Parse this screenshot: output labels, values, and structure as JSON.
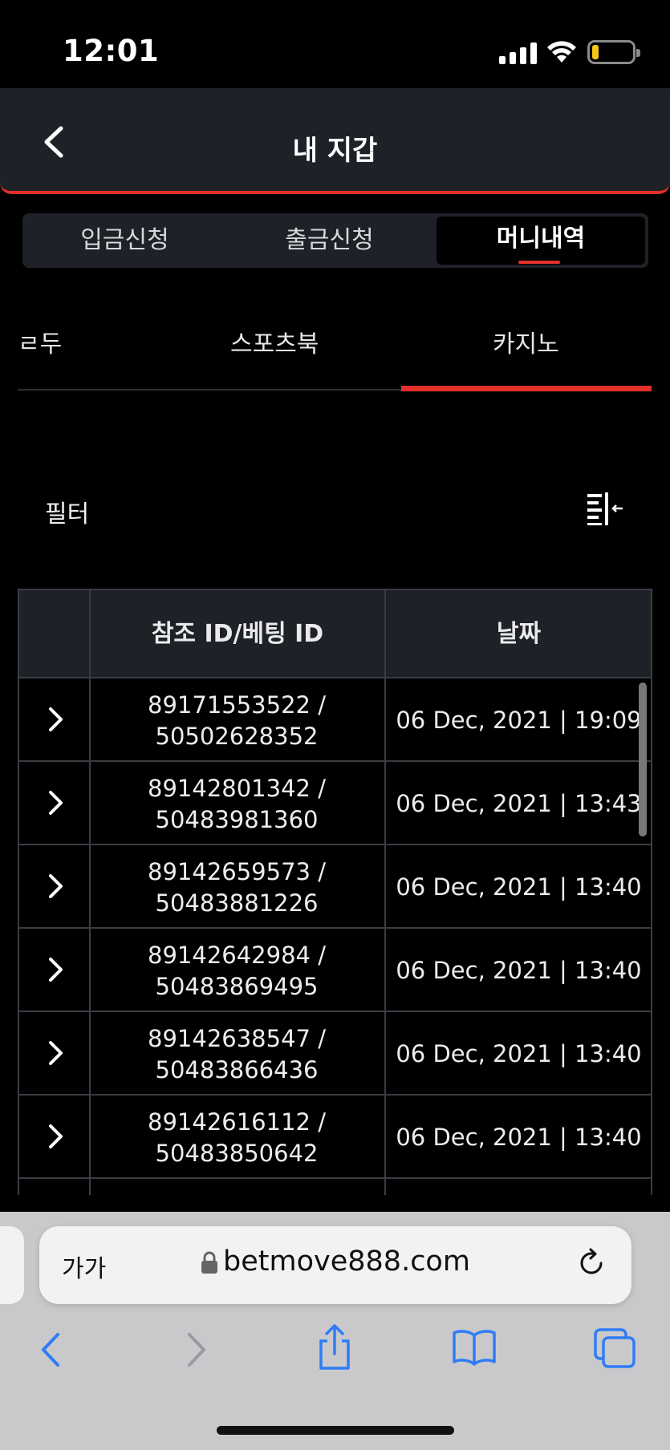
{
  "status": {
    "time": "12:01"
  },
  "header": {
    "title": "내 지갑"
  },
  "segments": [
    {
      "label": "입금신청",
      "active": false
    },
    {
      "label": "출금신청",
      "active": false
    },
    {
      "label": "머니내역",
      "active": true
    }
  ],
  "subtabs": [
    {
      "label": "모두",
      "visible_text": "ㄹ두"
    },
    {
      "label": "스포츠북"
    },
    {
      "label": "카지노",
      "active": true
    }
  ],
  "filter": {
    "label": "필터"
  },
  "table": {
    "columns": [
      "",
      "참조 ID/베팅 ID",
      "날짜"
    ],
    "rows": [
      {
        "ref": "89171553522 /",
        "bet": "50502628352",
        "date": "06 Dec, 2021 | 19:09"
      },
      {
        "ref": "89142801342 /",
        "bet": "50483981360",
        "date": "06 Dec, 2021 | 13:43"
      },
      {
        "ref": "89142659573 /",
        "bet": "50483881226",
        "date": "06 Dec, 2021 | 13:40"
      },
      {
        "ref": "89142642984 /",
        "bet": "50483869495",
        "date": "06 Dec, 2021 | 13:40"
      },
      {
        "ref": "89142638547 /",
        "bet": "50483866436",
        "date": "06 Dec, 2021 | 13:40"
      },
      {
        "ref": "89142616112 /",
        "bet": "50483850642",
        "date": "06 Dec, 2021 | 13:40"
      }
    ]
  },
  "browser": {
    "aa_label": "가가",
    "url": "betmove888.com"
  },
  "colors": {
    "accent": "#e3302a",
    "header_bg": "#1e2128",
    "battery": "#f5c518"
  }
}
